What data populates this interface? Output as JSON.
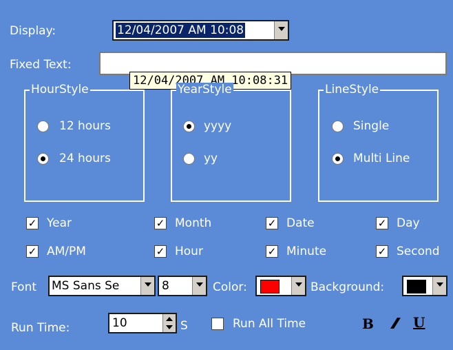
{
  "display": {
    "label": "Display:",
    "value": "12/04/2007 AM 10:08"
  },
  "fixed_text": {
    "label": "Fixed Text:",
    "value": ""
  },
  "tooltip": "12/04/2007 AM 10:08:31",
  "hour_style": {
    "title": "HourStyle",
    "options": [
      "12 hours",
      "24 hours"
    ],
    "selected": "24 hours"
  },
  "year_style": {
    "title": "YearStyle",
    "options": [
      "yyyy",
      "yy"
    ],
    "selected": "yyyy"
  },
  "line_style": {
    "title": "LineStyle",
    "options": [
      "Single",
      "Multi Line"
    ],
    "selected": "Multi Line"
  },
  "checkboxes": {
    "year": "Year",
    "month": "Month",
    "date": "Date",
    "day": "Day",
    "ampm": "AM/PM",
    "hour": "Hour",
    "minute": "Minute",
    "second": "Second"
  },
  "font": {
    "label": "Font",
    "family": "MS Sans Se",
    "size": "8"
  },
  "color": {
    "label": "Color:",
    "value": "#ff0000"
  },
  "background": {
    "label": "Background:",
    "value": "#000000"
  },
  "run_time": {
    "label": "Run Time:",
    "value": "10",
    "unit": "S",
    "run_all_label": "Run All Time",
    "run_all_checked": false
  },
  "format": {
    "bold": "B",
    "italic": "I",
    "underline": "U"
  }
}
